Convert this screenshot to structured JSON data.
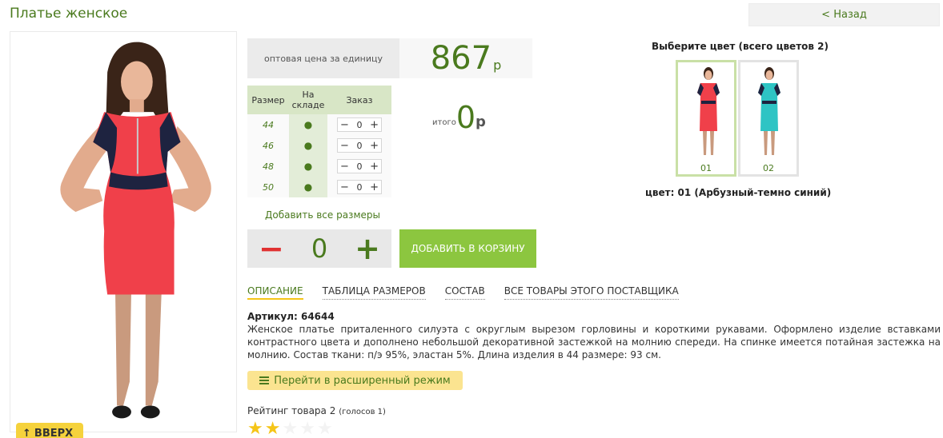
{
  "header": {
    "title": "Платье женское",
    "back_label": "< Назад"
  },
  "price": {
    "label": "оптовая цена за единицу",
    "value": "867",
    "currency": "р"
  },
  "sizes_table": {
    "headers": [
      "Размер",
      "На складе",
      "Заказ"
    ],
    "rows": [
      {
        "size": "44",
        "stock": "●",
        "qty": "0"
      },
      {
        "size": "46",
        "stock": "●",
        "qty": "0"
      },
      {
        "size": "48",
        "stock": "●",
        "qty": "0"
      },
      {
        "size": "50",
        "stock": "●",
        "qty": "0"
      }
    ],
    "minus": "−",
    "plus": "+"
  },
  "total": {
    "label": "итого",
    "value": "0",
    "currency": "р"
  },
  "add_all_sizes": "Добавить все размеры",
  "quantity": {
    "minus": "−",
    "value": "0",
    "plus": "+"
  },
  "cart_button": "ДОБАВИТЬ В КОРЗИНУ",
  "colors": {
    "heading": "Выберите цвет (всего цветов 2)",
    "options": [
      {
        "number": "01",
        "dress_color": "#f0404a",
        "accent_color": "#1e2340"
      },
      {
        "number": "02",
        "dress_color": "#2ec4c4",
        "accent_color": "#1e2340"
      }
    ],
    "caption": "цвет: 01 (Арбузный-темно синий)"
  },
  "tabs": [
    "ОПИСАНИЕ",
    "ТАБЛИЦА РАЗМЕРОВ",
    "СОСТАВ",
    "ВСЕ ТОВАРЫ ЭТОГО ПОСТАВЩИКА"
  ],
  "article": "Артикул: 64644",
  "description": "Женское платье приталенного силуэта с округлым вырезом горловины и короткими рукавами. Оформлено изделие вставками контрастного цвета и дополнено небольшой декоративной застежкой на молнию спереди. На спинке имеется потайная застежка на молнию. Состав ткани: п/э 95%, эластан 5%. Длина изделия в 44 размере: 93 см.",
  "extended_mode": "Перейти в расширенный режим",
  "rating": {
    "label": "Рейтинг товара 2",
    "votes": "(голосов 1)",
    "value": 2,
    "max": 5
  },
  "to_top": "ВВЕРХ",
  "theme": {
    "accent": "#4a7a1e",
    "cart_green": "#8cc63f",
    "minus_red": "#e03131",
    "star": "#f5c518"
  }
}
